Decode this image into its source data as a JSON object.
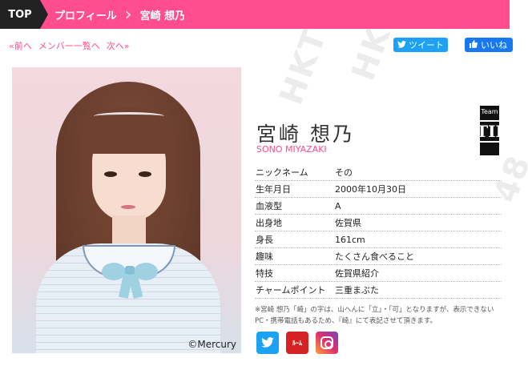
{
  "breadcrumb": {
    "top": "TOP",
    "profile": "プロフィール",
    "member": "宮崎 想乃"
  },
  "nav": {
    "prev": "«前へ",
    "list": "メンバー一覧へ",
    "next": "次へ»"
  },
  "social_share": {
    "tweet": "ツイート",
    "like": "いいね"
  },
  "profile": {
    "name": "宮崎 想乃",
    "name_romaji": "SONO MIYAZAKI",
    "photo_credit": "©Mercury",
    "team": {
      "label": "Team",
      "name": "TII"
    },
    "fields": [
      {
        "label": "ニックネーム",
        "value": "その"
      },
      {
        "label": "生年月日",
        "value": "2000年10月30日"
      },
      {
        "label": "血液型",
        "value": "A"
      },
      {
        "label": "出身地",
        "value": "佐賀県"
      },
      {
        "label": "身長",
        "value": "161cm"
      },
      {
        "label": "趣味",
        "value": "たくさん食べること"
      },
      {
        "label": "特技",
        "value": "佐賀県紹介"
      },
      {
        "label": "チャームポイント",
        "value": "三重まぶた"
      }
    ],
    "note": "※宮崎 想乃「崎」の字は、山へんに「立」・「可」となりますが、表示できないPC・携帯電話もあるため、『崎』にて表記させて頂きます。"
  },
  "sns": {
    "twitter_icon": "twitter-icon",
    "showroom_label": "ﾙｰﾑ",
    "instagram_icon": "instagram-icon"
  },
  "colors": {
    "accent": "#ff4d8d",
    "dark": "#222222",
    "twitter": "#1da1f2",
    "facebook": "#1877f2"
  }
}
